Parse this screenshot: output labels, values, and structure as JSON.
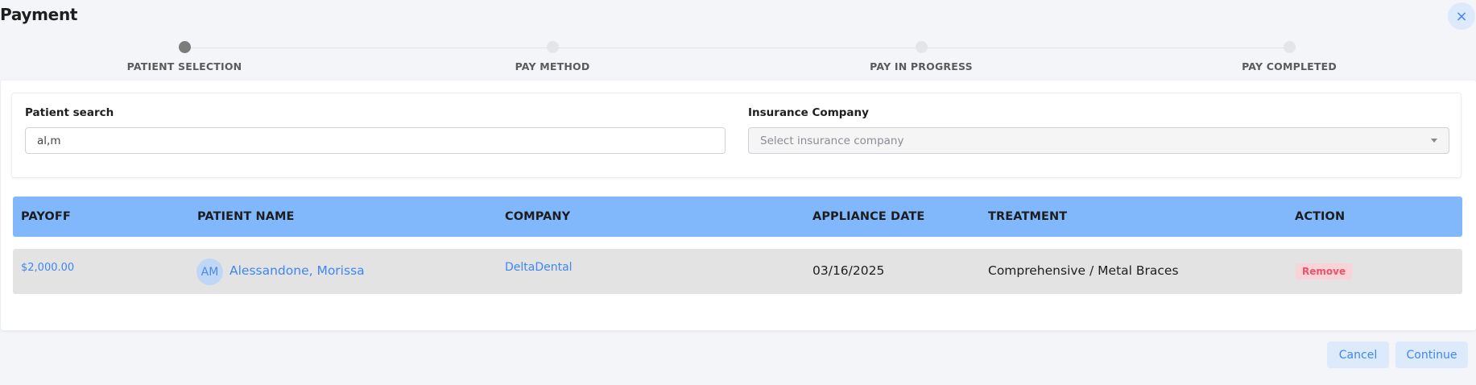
{
  "header": {
    "title": "Payment",
    "close_icon": "×"
  },
  "stepper": {
    "steps": [
      {
        "label": "PATIENT SELECTION",
        "active": true
      },
      {
        "label": "PAY METHOD",
        "active": false
      },
      {
        "label": "PAY IN PROGRESS",
        "active": false
      },
      {
        "label": "PAY COMPLETED",
        "active": false
      }
    ]
  },
  "filters": {
    "patient_search": {
      "label": "Patient search",
      "value": "al,m"
    },
    "insurance_company": {
      "label": "Insurance Company",
      "placeholder": "Select insurance company"
    }
  },
  "table": {
    "columns": [
      "PAYOFF",
      "PATIENT NAME",
      "COMPANY",
      "APPLIANCE DATE",
      "TREATMENT",
      "ACTION"
    ],
    "rows": [
      {
        "payoff": "$2,000.00",
        "avatar_initials": "AM",
        "patient_name": "Alessandone, Morissa",
        "company": "DeltaDental",
        "appliance_date": "03/16/2025",
        "treatment": "Comprehensive / Metal Braces",
        "action": "Remove"
      }
    ]
  },
  "footer": {
    "cancel_label": "Cancel",
    "continue_label": "Continue"
  },
  "colors": {
    "accent": "#3d87f5",
    "table_header": "#80b8fb",
    "row_bg": "#e3e3e3",
    "remove_bg": "#f9d3d8",
    "remove_text": "#e5556a"
  }
}
